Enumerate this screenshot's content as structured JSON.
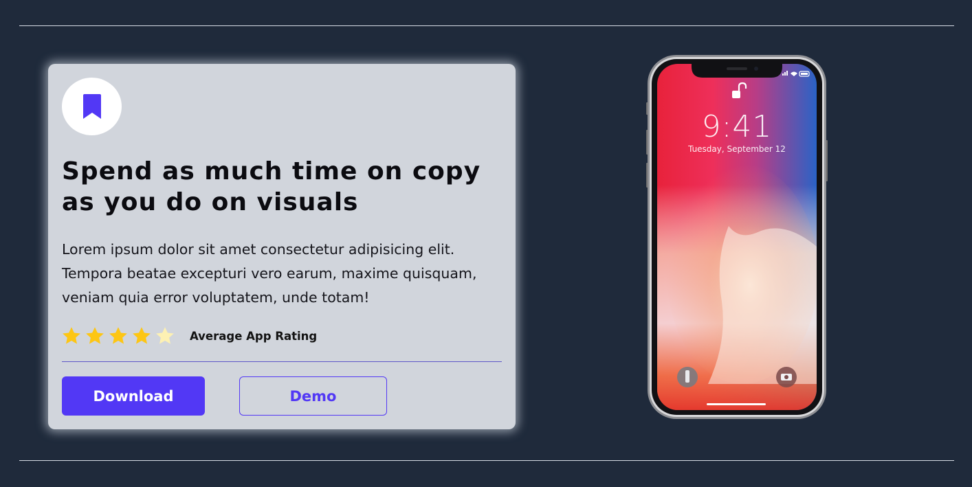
{
  "card": {
    "icon": "bookmark-icon",
    "headline": "Spend as much time on copy as you do on visuals",
    "body": "Lorem ipsum dolor sit amet consectetur adipisicing elit. Tempora beatae excepturi vero earum, maxime quisquam, veniam quia error voluptatem, unde totam!",
    "rating": {
      "stars_filled": 4,
      "stars_total": 5,
      "label": "Average App Rating"
    },
    "buttons": {
      "primary_label": "Download",
      "secondary_label": "Demo"
    }
  },
  "phone": {
    "time": "9:41",
    "date": "Tuesday, September 12"
  },
  "colors": {
    "background": "#1f2a3b",
    "card": "#d1d5dc",
    "accent": "#5238f5",
    "star_filled": "#fdc614",
    "star_empty": "#fdf1b3"
  }
}
